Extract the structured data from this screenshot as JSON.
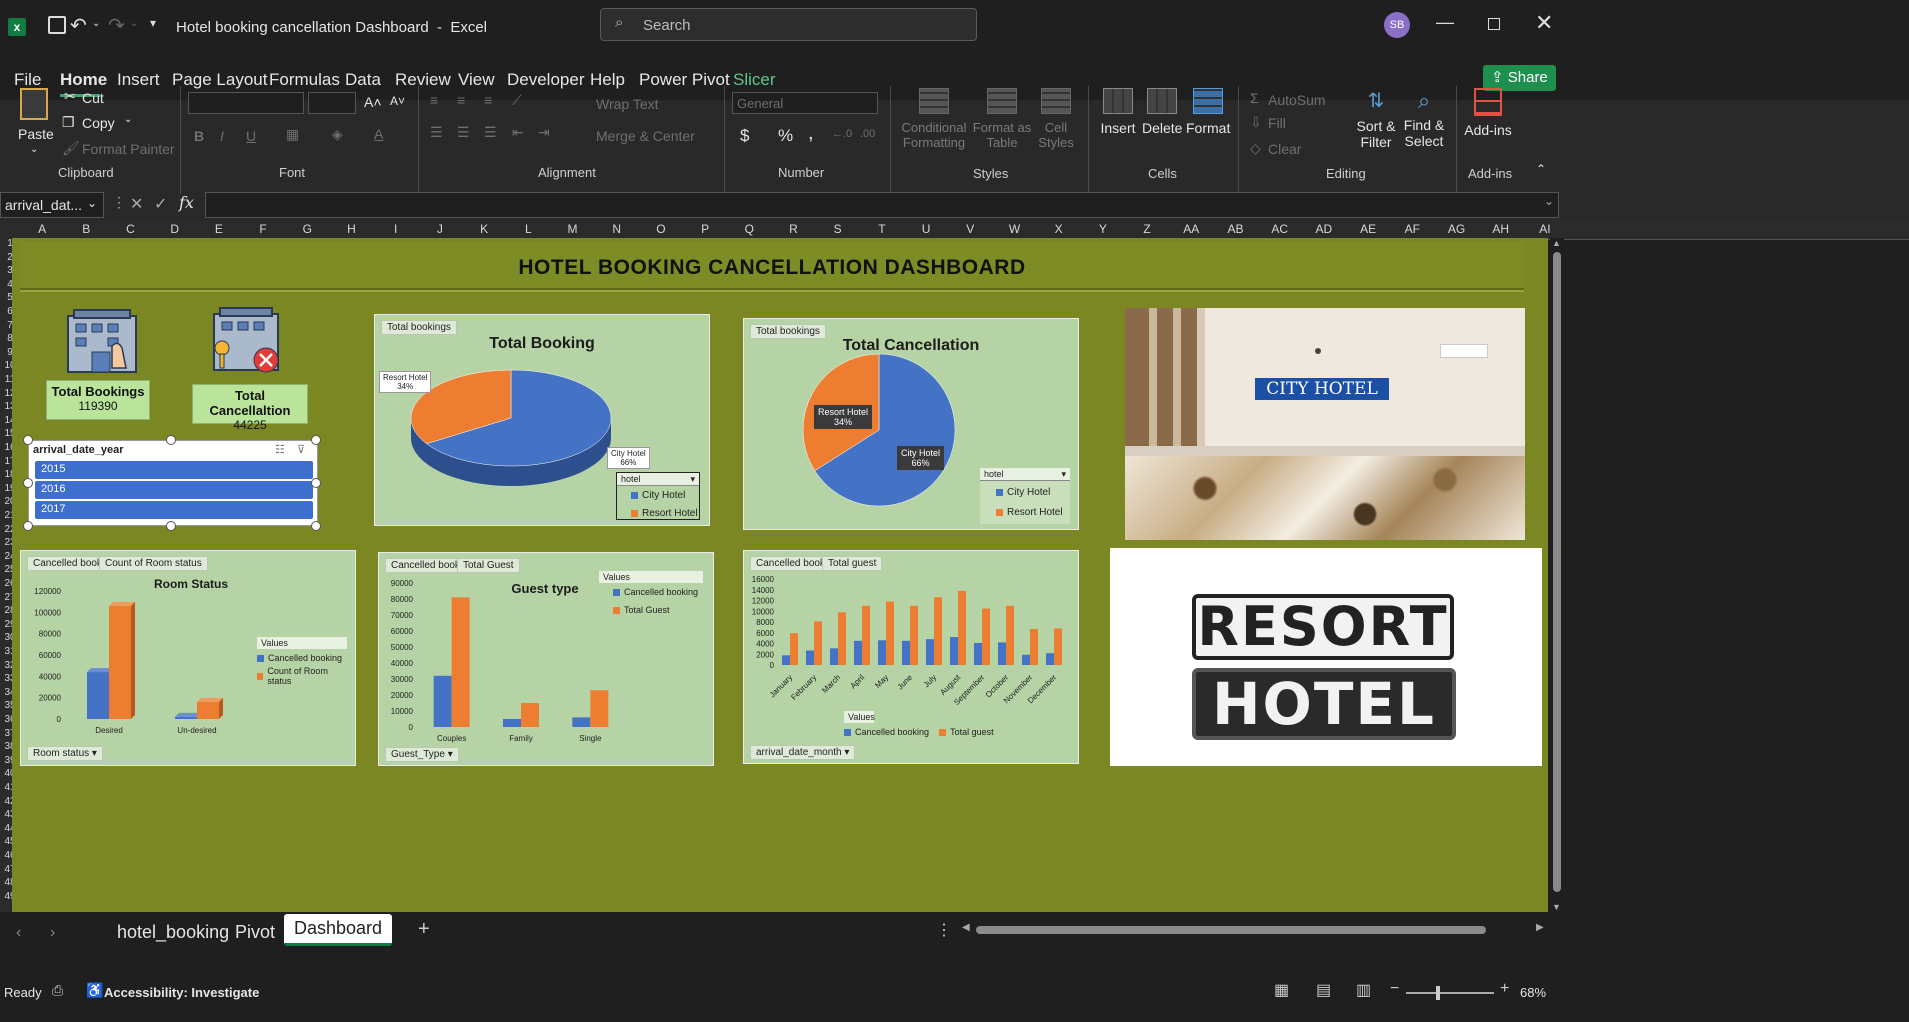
{
  "window": {
    "title": "Hotel booking cancellation Dashboard  -  Excel",
    "app_icon": "excel-icon",
    "user_initials": "SB",
    "search_placeholder": "Search"
  },
  "menu": [
    "File",
    "Home",
    "Insert",
    "Page Layout",
    "Formulas",
    "Data",
    "Review",
    "View",
    "Developer",
    "Help",
    "Power Pivot",
    "Slicer"
  ],
  "share_label": "Share",
  "ribbon": {
    "clipboard": {
      "label": "Clipboard",
      "paste": "Paste",
      "cut": "Cut",
      "copy": "Copy",
      "format_painter": "Format Painter"
    },
    "font": {
      "label": "Font",
      "bold": "B",
      "italic": "I",
      "underline": "U"
    },
    "alignment": {
      "label": "Alignment",
      "wrap": "Wrap Text",
      "merge": "Merge & Center"
    },
    "number": {
      "label": "Number",
      "format": "General",
      "currency": "$",
      "percent": "%",
      "comma": ","
    },
    "styles": {
      "label": "Styles",
      "conditional_1": "Conditional",
      "conditional_2": "Formatting",
      "format_table_1": "Format as",
      "format_table_2": "Table",
      "cell_styles_1": "Cell",
      "cell_styles_2": "Styles"
    },
    "cells": {
      "label": "Cells",
      "insert": "Insert",
      "delete": "Delete",
      "format": "Format"
    },
    "editing": {
      "label": "Editing",
      "autosum": "AutoSum",
      "fill": "Fill",
      "clear": "Clear",
      "sort_1": "Sort &",
      "sort_2": "Filter",
      "find_1": "Find &",
      "find_2": "Select"
    },
    "addins": {
      "label": "Add-ins",
      "button": "Add-ins"
    }
  },
  "formula_bar": {
    "name_box": "arrival_dat...",
    "fx": "fx",
    "value": ""
  },
  "columns": [
    "A",
    "B",
    "C",
    "D",
    "E",
    "F",
    "G",
    "H",
    "I",
    "J",
    "K",
    "L",
    "M",
    "N",
    "O",
    "P",
    "Q",
    "R",
    "S",
    "T",
    "U",
    "V",
    "W",
    "X",
    "Y",
    "Z",
    "AA",
    "AB",
    "AC",
    "AD",
    "AE",
    "AF",
    "AG",
    "AH",
    "AI"
  ],
  "rows": [
    "1",
    "2",
    "3",
    "4",
    "5",
    "6",
    "7",
    "8",
    "9",
    "10",
    "11",
    "12",
    "13",
    "14",
    "15",
    "16",
    "17",
    "18",
    "19",
    "20",
    "21",
    "22",
    "23",
    "24",
    "25",
    "26",
    "27",
    "28",
    "29",
    "30",
    "31",
    "32",
    "33",
    "34",
    "35",
    "36",
    "37",
    "38",
    "39",
    "40",
    "41",
    "42",
    "43",
    "44",
    "45",
    "46",
    "47",
    "48",
    "49"
  ],
  "dashboard": {
    "title": "HOTEL BOOKING CANCELLATION DASHBOARD",
    "kpi_bookings": {
      "label": "Total Bookings",
      "value": "119390"
    },
    "kpi_cancel": {
      "label": "Total Cancellaltion",
      "value": "44225"
    },
    "slicer": {
      "header": "arrival_date_year",
      "items": [
        "2015",
        "2016",
        "2017"
      ]
    },
    "city_hotel_sign": "CITY HOTEL",
    "resort_sign_1": "RESORT",
    "resort_sign_2": "HOTEL"
  },
  "chart_data": [
    {
      "type": "pie",
      "title": "Total Booking",
      "chip": "Total bookings",
      "labels": [
        "City Hotel",
        "Resort Hotel"
      ],
      "values": [
        66,
        34
      ],
      "data_labels": [
        "City Hotel\n66%",
        "Resort Hotel\n34%"
      ],
      "filter_label": "hotel",
      "legend": [
        "City Hotel",
        "Resort Hotel"
      ]
    },
    {
      "type": "pie",
      "title": "Total Cancellation",
      "chip": "Total bookings",
      "labels": [
        "City Hotel",
        "Resort Hotel"
      ],
      "values": [
        66,
        34
      ],
      "data_labels": [
        "City Hotel\n66%",
        "Resort Hotel\n34%"
      ],
      "filter_label": "hotel",
      "legend": [
        "City Hotel",
        "Resort Hotel"
      ]
    },
    {
      "type": "bar",
      "title": "Room Status",
      "chips": [
        "Cancelled booking",
        "Count of Room status"
      ],
      "categories": [
        "Desired",
        "Un-desired"
      ],
      "series": [
        {
          "name": "Cancelled booking",
          "values": [
            44000,
            2000
          ]
        },
        {
          "name": "Count of Room status",
          "values": [
            106000,
            16000
          ]
        }
      ],
      "yticks": [
        "120000",
        "100000",
        "80000",
        "60000",
        "40000",
        "20000",
        "0"
      ],
      "ylim": [
        0,
        120000
      ],
      "legend_title": "Values",
      "filter_label": "Room status"
    },
    {
      "type": "bar",
      "title": "Guest type",
      "chips": [
        "Cancelled booking",
        "Total Guest"
      ],
      "categories": [
        "Couples",
        "Family",
        "Single"
      ],
      "series": [
        {
          "name": "Cancelled booking",
          "values": [
            32000,
            5000,
            6000
          ]
        },
        {
          "name": "Total Guest",
          "values": [
            81000,
            15000,
            23000
          ]
        }
      ],
      "yticks": [
        "90000",
        "80000",
        "70000",
        "60000",
        "50000",
        "40000",
        "30000",
        "20000",
        "10000",
        "0"
      ],
      "ylim": [
        0,
        90000
      ],
      "legend_title": "Values",
      "filter_label": "Guest_Type"
    },
    {
      "type": "bar",
      "title": "",
      "chips": [
        "Cancelled booking",
        "Total guest"
      ],
      "categories": [
        "January",
        "February",
        "March",
        "April",
        "May",
        "June",
        "July",
        "August",
        "September",
        "October",
        "November",
        "December"
      ],
      "series": [
        {
          "name": "Cancelled booking",
          "values": [
            1800,
            2700,
            3100,
            4500,
            4600,
            4500,
            4800,
            5200,
            4100,
            4200,
            1900,
            2200
          ]
        },
        {
          "name": "Total guest",
          "values": [
            5900,
            8100,
            9800,
            11000,
            11800,
            11000,
            12600,
            13800,
            10500,
            11000,
            6700,
            6800
          ]
        }
      ],
      "yticks": [
        "16000",
        "14000",
        "12000",
        "10000",
        "8000",
        "6000",
        "4000",
        "2000",
        "0"
      ],
      "ylim": [
        0,
        16000
      ],
      "legend_title": "Values",
      "filter_label": "arrival_date_month"
    }
  ],
  "sheet_tabs": [
    "hotel_booking",
    "Pivot",
    "Dashboard"
  ],
  "active_tab": "Dashboard",
  "status": {
    "ready": "Ready",
    "accessibility": "Accessibility: Investigate",
    "zoom": "68%"
  },
  "colors": {
    "excel_green": "#107c41",
    "blue": "#4472c4",
    "orange": "#ed7d31",
    "dashboard_bg": "#7a8722",
    "panel_bg": "#b5d3a4"
  }
}
